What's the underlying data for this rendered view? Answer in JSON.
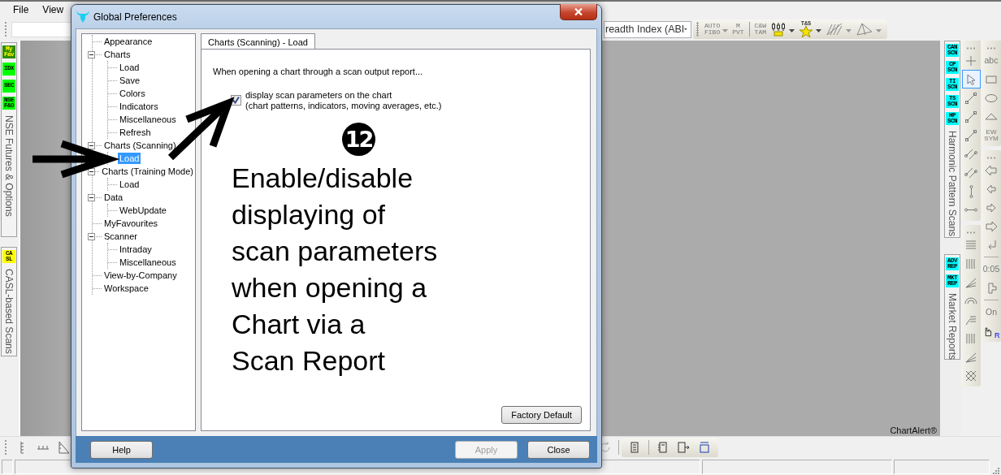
{
  "menu": [
    {
      "label": "File"
    },
    {
      "label": "View"
    }
  ],
  "toolbar": {
    "combo_value": "readth Index (ABI",
    "tools": [
      {
        "kind": "text",
        "lines": [
          "AUTO",
          "FIBO"
        ],
        "dropdown": true
      },
      {
        "kind": "text",
        "lines": [
          "M",
          "PVT"
        ],
        "dropdown": false
      },
      {
        "kind": "separator"
      },
      {
        "kind": "text",
        "lines": [
          "C&W",
          "TAM"
        ],
        "dropdown": false
      },
      {
        "kind": "candles",
        "dropdown": true
      },
      {
        "kind": "star",
        "lines": [
          "T&S"
        ],
        "dropdown": true
      },
      {
        "kind": "fork",
        "dropdown": true
      },
      {
        "kind": "triangle",
        "dropdown": true
      }
    ]
  },
  "left_tabs": [
    {
      "label": "NSE Futures & Options",
      "badges": [
        {
          "lines": [
            "My",
            "Fav"
          ],
          "color": "#2f8a00"
        },
        {
          "lines": [
            "IDX"
          ],
          "color": "#00ff00"
        },
        {
          "lines": [
            "SEC"
          ],
          "color": "#00ff00"
        },
        {
          "lines": [
            "NSE",
            "F&O"
          ],
          "color": "#00ff00"
        }
      ]
    },
    {
      "label": "CASL-based Scans",
      "badges": [
        {
          "lines": [
            "CA",
            "SL"
          ],
          "color": "#ffff00"
        }
      ]
    }
  ],
  "chart": {
    "brand": "ChartAlert®"
  },
  "right_tabs": [
    {
      "label": "Harmonic Pattern Scans",
      "badges": [
        {
          "lines": [
            "CAN",
            "SCN"
          ],
          "color": "#00ffff"
        },
        {
          "lines": [
            "CP",
            "SCN"
          ],
          "color": "#00ffff"
        },
        {
          "lines": [
            "TI",
            "SCN"
          ],
          "color": "#00ffff"
        },
        {
          "lines": [
            "TS",
            "SCN"
          ],
          "color": "#00ffff"
        },
        {
          "lines": [
            "HP",
            "SCN"
          ],
          "color": "#00ffff"
        }
      ]
    },
    {
      "label": "Market Reports",
      "badges": [
        {
          "lines": [
            "ADV",
            "REP"
          ],
          "color": "#00ffff"
        },
        {
          "lines": [
            "MKT",
            "REP"
          ],
          "color": "#00ffff"
        }
      ]
    }
  ],
  "palette": [
    [
      [
        {
          "kind": "plus",
          "selected": false
        },
        {
          "kind": "pointer",
          "selected": true
        },
        {
          "kind": "line",
          "selected": false
        },
        {
          "kind": "line",
          "selected": false
        },
        {
          "kind": "line",
          "selected": false
        },
        {
          "kind": "channel",
          "selected": false
        },
        {
          "kind": "channel",
          "selected": false
        },
        {
          "kind": "vline",
          "selected": false
        },
        {
          "kind": "hline",
          "selected": false
        }
      ],
      [
        {
          "kind": "hlines",
          "selected": false
        },
        {
          "kind": "vlines",
          "selected": false
        },
        {
          "kind": "fan",
          "selected": false
        },
        {
          "kind": "arc",
          "selected": false
        },
        {
          "kind": "ext",
          "selected": false
        },
        {
          "kind": "vlines",
          "selected": false
        },
        {
          "kind": "fan",
          "selected": false
        },
        {
          "kind": "lattice",
          "selected": false
        }
      ]
    ],
    [
      [
        {
          "kind": "text",
          "lines": [
            "abc"
          ],
          "selected": false
        },
        {
          "kind": "rect",
          "selected": false
        },
        {
          "kind": "ellipse",
          "selected": false
        },
        {
          "kind": "triangle",
          "selected": false
        },
        {
          "kind": "text",
          "lines": [
            "EW",
            "SYM"
          ],
          "selected": false
        }
      ],
      [
        {
          "kind": "arrow-left-big",
          "selected": false
        },
        {
          "kind": "arrow-left",
          "selected": false
        },
        {
          "kind": "arrow-right",
          "selected": false
        },
        {
          "kind": "arrow-right-big",
          "selected": false
        },
        {
          "kind": "arrow-return",
          "selected": false
        },
        {
          "kind": "separator"
        },
        {
          "kind": "text",
          "lines": [
            "0:05"
          ],
          "selected": false
        },
        {
          "kind": "step",
          "selected": false
        },
        {
          "kind": "separator"
        },
        {
          "kind": "text",
          "lines": [
            "On"
          ],
          "selected": false
        },
        {
          "kind": "hand",
          "lines": [
            "R"
          ],
          "selected": false
        }
      ]
    ]
  ],
  "dialog": {
    "title": "Global Preferences",
    "tree": [
      {
        "label": "Appearance",
        "selected": false
      },
      {
        "label": "Charts",
        "selected": false,
        "expanded": true,
        "children": [
          {
            "label": "Load",
            "selected": false
          },
          {
            "label": "Save",
            "selected": false
          },
          {
            "label": "Colors",
            "selected": false
          },
          {
            "label": "Indicators",
            "selected": false
          },
          {
            "label": "Miscellaneous",
            "selected": false
          },
          {
            "label": "Refresh",
            "selected": false
          }
        ]
      },
      {
        "label": "Charts (Scanning)",
        "selected": false,
        "expanded": true,
        "children": [
          {
            "label": "Load",
            "selected": true
          }
        ]
      },
      {
        "label": "Charts (Training Mode)",
        "selected": false,
        "expanded": true,
        "children": [
          {
            "label": "Load",
            "selected": false
          }
        ]
      },
      {
        "label": "Data",
        "selected": false,
        "expanded": true,
        "children": [
          {
            "label": "WebUpdate",
            "selected": false
          }
        ]
      },
      {
        "label": "MyFavourites",
        "selected": false
      },
      {
        "label": "Scanner",
        "selected": false,
        "expanded": true,
        "children": [
          {
            "label": "Intraday",
            "selected": false
          },
          {
            "label": "Miscellaneous",
            "selected": false
          }
        ]
      },
      {
        "label": "View-by-Company",
        "selected": false
      },
      {
        "label": "Workspace",
        "selected": false
      }
    ],
    "tabs": [
      {
        "label": "Charts (Scanning) - Load",
        "selected": true
      }
    ],
    "intro": "When opening a chart through a scan output report...",
    "option": {
      "label": "display scan parameters on the chart",
      "detail": "(chart patterns, indicators, moving averages, etc.)",
      "checked": true
    },
    "factory_button": "Factory Default",
    "buttons": [
      {
        "label": "Help",
        "disabled": false
      },
      {
        "label": "Apply",
        "disabled": true
      },
      {
        "label": "Close",
        "disabled": false
      }
    ]
  },
  "annotation": {
    "step": "12",
    "lines": [
      "Enable/disable",
      "displaying of",
      "scan parameters",
      "when opening a",
      "Chart via a",
      "Scan Report"
    ]
  }
}
